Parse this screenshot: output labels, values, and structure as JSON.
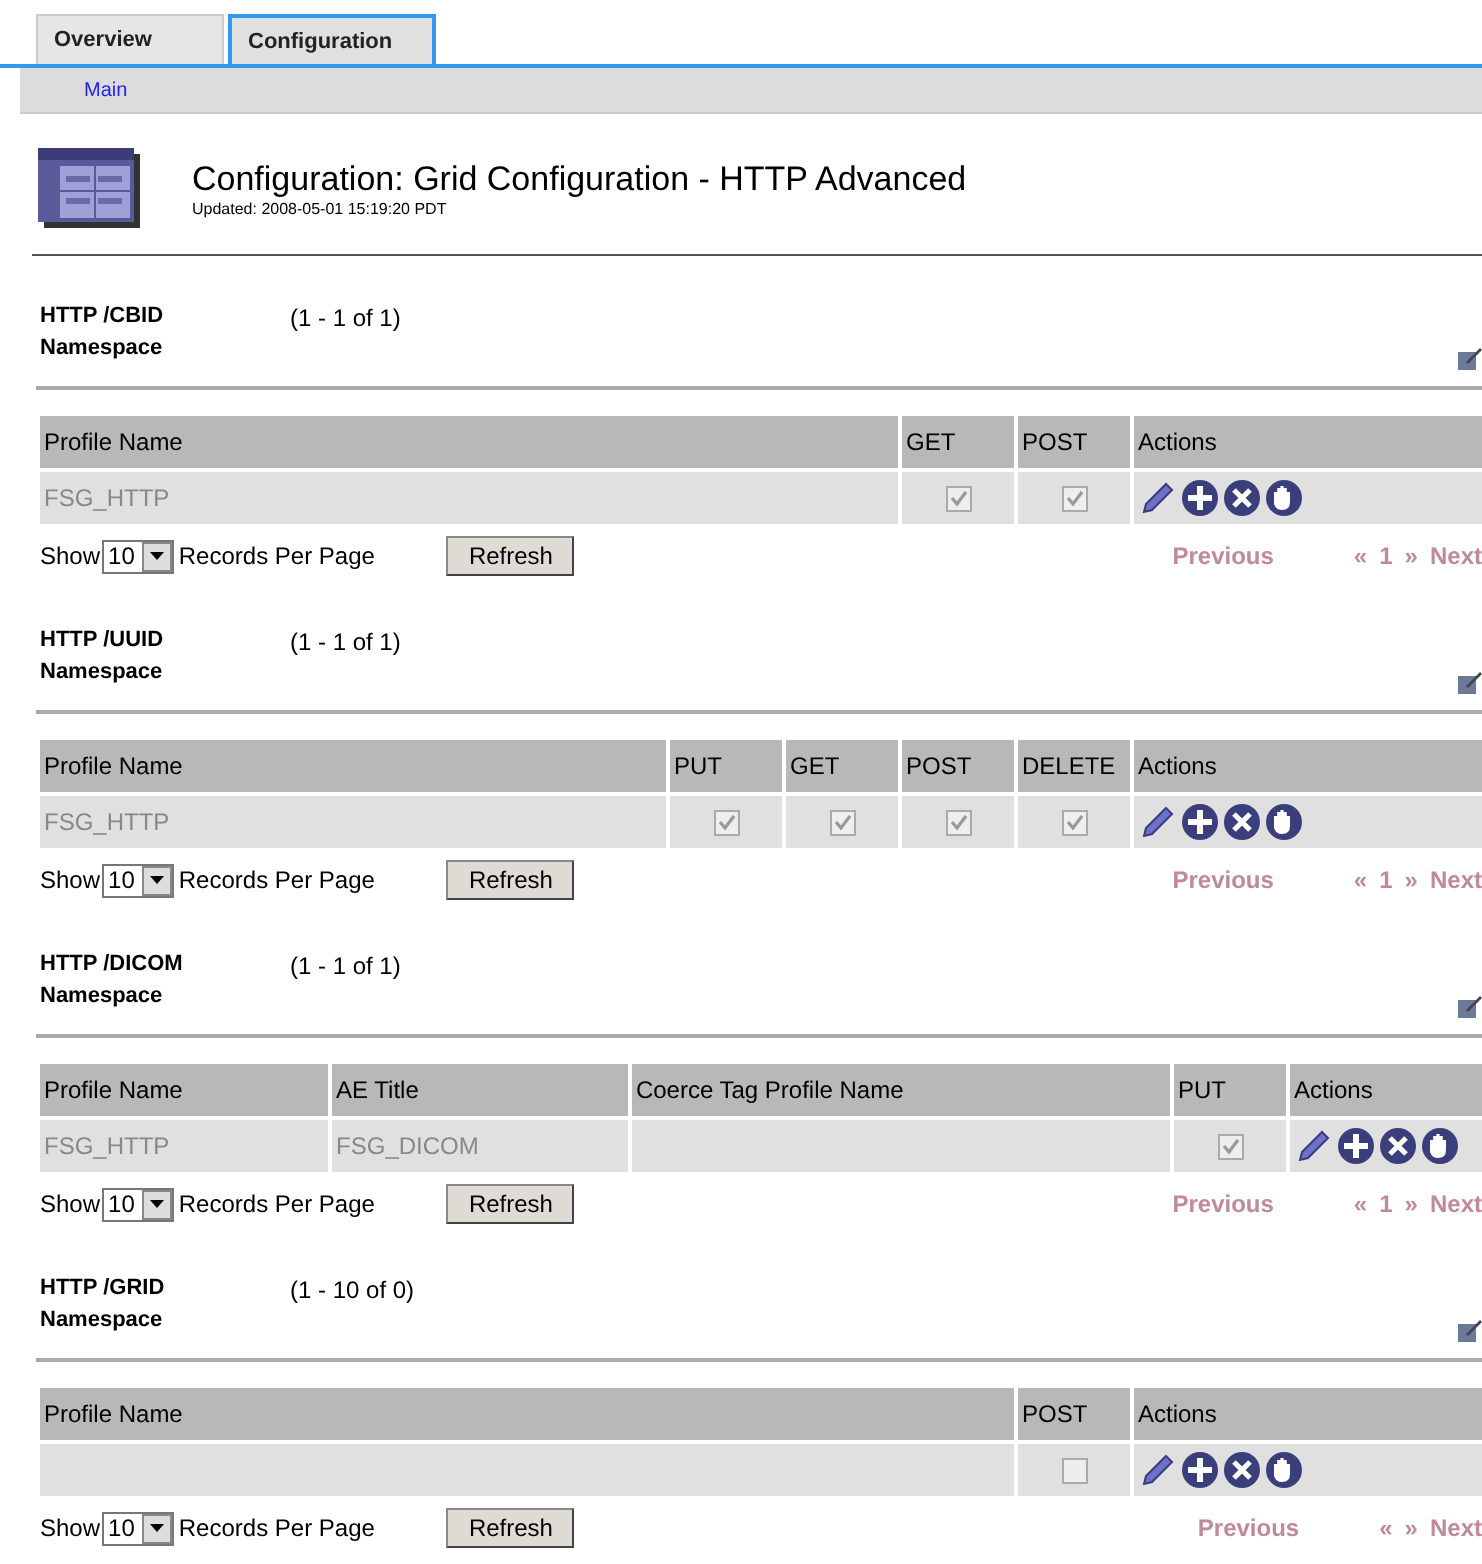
{
  "tabs": [
    {
      "label": "Overview",
      "selected": false
    },
    {
      "label": "Configuration",
      "selected": true
    }
  ],
  "subnav": {
    "items": [
      "Main"
    ]
  },
  "header": {
    "title": "Configuration: Grid Configuration - HTTP Advanced",
    "updated": "Updated: 2008-05-01 15:19:20 PDT"
  },
  "sections": [
    {
      "title": "HTTP /CBID Namespace",
      "count": "(1 - 1 of 1)",
      "columns": [
        {
          "label": "Profile Name",
          "kind": "text"
        },
        {
          "label": "GET",
          "kind": "check"
        },
        {
          "label": "POST",
          "kind": "check"
        },
        {
          "label": "Actions",
          "kind": "actions"
        }
      ],
      "rows": [
        {
          "cells": [
            {
              "text": "FSG_HTTP"
            },
            {
              "checked": true
            },
            {
              "checked": true
            },
            {}
          ]
        }
      ],
      "footer": {
        "show": "Show",
        "per_page": "10",
        "records": "Records Per Page",
        "refresh": "Refresh",
        "previous": "Previous",
        "first": "«",
        "page": "1",
        "last": "»",
        "next": "Next"
      }
    },
    {
      "title": "HTTP /UUID Namespace",
      "count": "(1 - 1 of 1)",
      "columns": [
        {
          "label": "Profile Name",
          "kind": "text"
        },
        {
          "label": "PUT",
          "kind": "check"
        },
        {
          "label": "GET",
          "kind": "check"
        },
        {
          "label": "POST",
          "kind": "check"
        },
        {
          "label": "DELETE",
          "kind": "check"
        },
        {
          "label": "Actions",
          "kind": "actions"
        }
      ],
      "rows": [
        {
          "cells": [
            {
              "text": "FSG_HTTP"
            },
            {
              "checked": true
            },
            {
              "checked": true
            },
            {
              "checked": true
            },
            {
              "checked": true
            },
            {}
          ]
        }
      ],
      "footer": {
        "show": "Show",
        "per_page": "10",
        "records": "Records Per Page",
        "refresh": "Refresh",
        "previous": "Previous",
        "first": "«",
        "page": "1",
        "last": "»",
        "next": "Next"
      }
    },
    {
      "title": "HTTP /DICOM Namespace",
      "count": "(1 - 1 of 1)",
      "columns": [
        {
          "label": "Profile Name",
          "kind": "text"
        },
        {
          "label": "AE Title",
          "kind": "text"
        },
        {
          "label": "Coerce Tag Profile Name",
          "kind": "text"
        },
        {
          "label": "PUT",
          "kind": "check"
        },
        {
          "label": "Actions",
          "kind": "actions"
        }
      ],
      "rows": [
        {
          "cells": [
            {
              "text": "FSG_HTTP"
            },
            {
              "text": "FSG_DICOM"
            },
            {},
            {
              "checked": true
            },
            {}
          ]
        }
      ],
      "footer": {
        "show": "Show",
        "per_page": "10",
        "records": "Records Per Page",
        "refresh": "Refresh",
        "previous": "Previous",
        "first": "«",
        "page": "1",
        "last": "»",
        "next": "Next"
      }
    },
    {
      "title": "HTTP /GRID Namespace",
      "count": "(1 - 10 of 0)",
      "columns": [
        {
          "label": "Profile Name",
          "kind": "text"
        },
        {
          "label": "POST",
          "kind": "check"
        },
        {
          "label": "Actions",
          "kind": "actions"
        }
      ],
      "rows": [
        {
          "cells": [
            {},
            {
              "checked": false
            },
            {}
          ]
        }
      ],
      "footer": {
        "show": "Show",
        "per_page": "10",
        "records": "Records Per Page",
        "refresh": "Refresh",
        "previous": "Previous",
        "first": "«",
        "last": "»",
        "next": "Next"
      }
    }
  ]
}
